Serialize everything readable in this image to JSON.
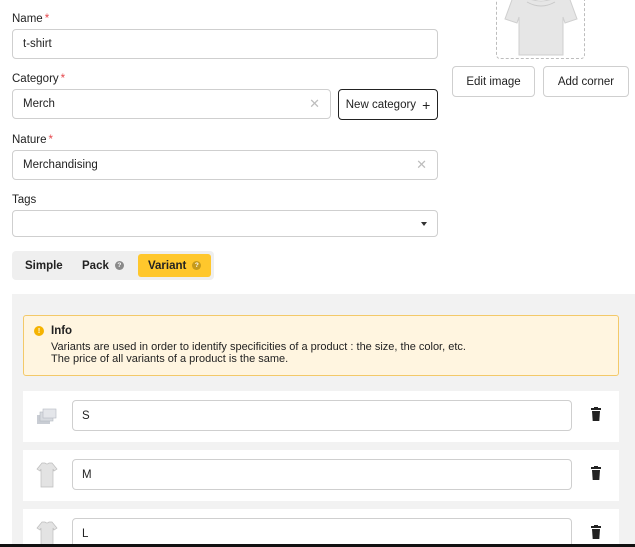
{
  "form": {
    "name": {
      "label": "Name",
      "required": "*",
      "value": "t-shirt"
    },
    "category": {
      "label": "Category",
      "required": "*",
      "value": "Merch",
      "clear_icon": "close-icon"
    },
    "nature": {
      "label": "Nature",
      "required": "*",
      "value": "Merchandising",
      "clear_icon": "close-icon"
    },
    "tags": {
      "label": "Tags",
      "value": "",
      "dropdown_icon": "caret-down-icon"
    },
    "new_category_button": {
      "label": "New category",
      "icon": "plus-icon",
      "plus": "+"
    }
  },
  "image": {
    "edit_button": "Edit image",
    "corner_button": "Add corner"
  },
  "tabs": [
    {
      "label": "Simple",
      "help": ""
    },
    {
      "label": "Pack",
      "help": "?"
    },
    {
      "label": "Variant",
      "help": "?"
    }
  ],
  "active_tab": "Variant",
  "info": {
    "icon": "info-icon",
    "icon_glyph": "!",
    "title": "Info",
    "line1": "Variants are used in order to identify specificities of a product : the size, the color, etc.",
    "line2": "The price of all variants of a product is the same."
  },
  "variants": [
    {
      "value": "S",
      "icon": "variant-placeholder-icon"
    },
    {
      "value": "M",
      "icon": "tshirt-icon"
    },
    {
      "value": "L",
      "icon": "tshirt-icon"
    }
  ],
  "colors": {
    "accent": "#ffc72c",
    "required": "#e5484d",
    "info_bg": "#fff5e0",
    "info_border": "#f3c969"
  }
}
